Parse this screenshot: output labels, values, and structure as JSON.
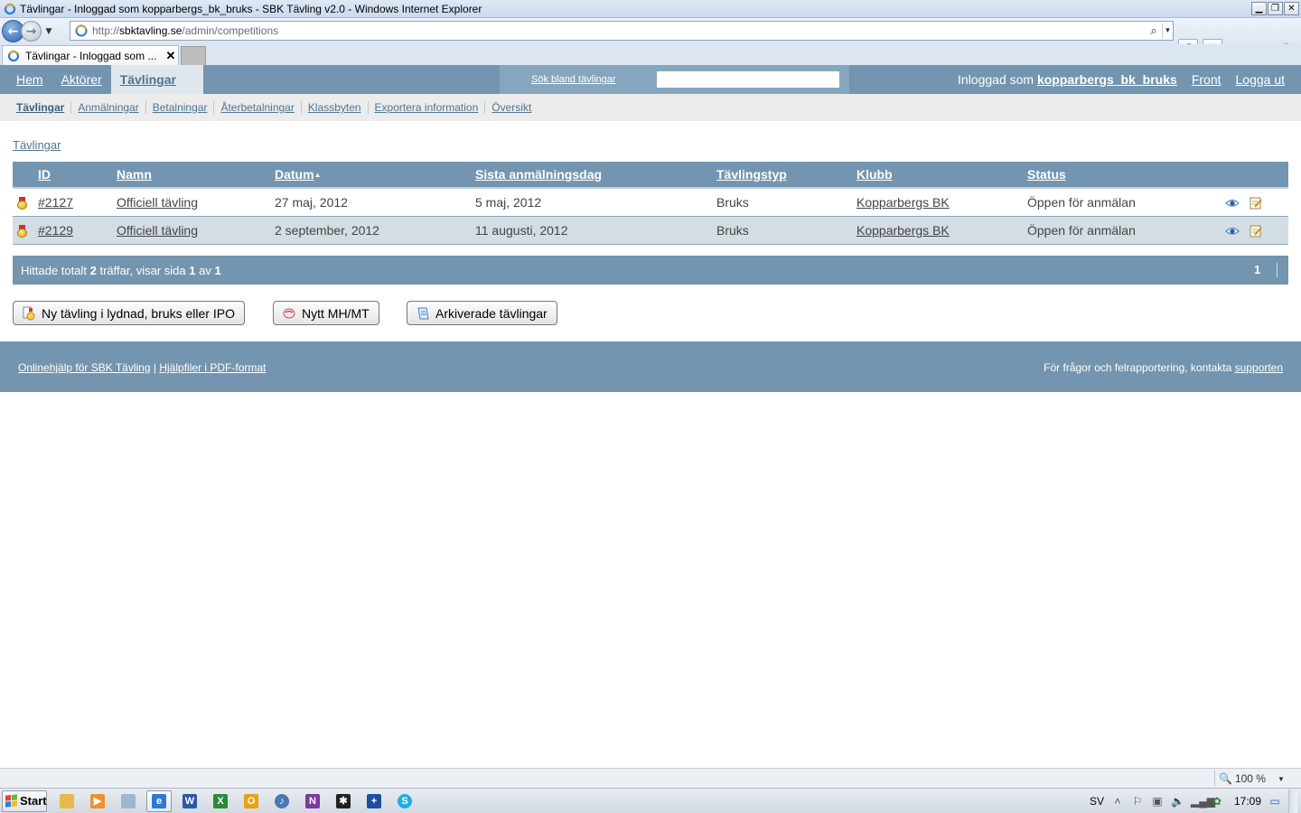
{
  "browser": {
    "window_title": "Tävlingar - Inloggad som kopparbergs_bk_bruks - SBK Tävling v2.0 - Windows Internet Explorer",
    "window_controls": [
      "minimize",
      "restore",
      "close"
    ],
    "address": {
      "scheme": "http://",
      "host": "sbktavling.se",
      "path": "/admin/competitions"
    },
    "tab_title": "Tävlingar - Inloggad som ...",
    "tab_close": "✕",
    "zoom": "100 %"
  },
  "header": {
    "main_nav": [
      "Hem",
      "Aktörer",
      "Tävlingar"
    ],
    "active_tab": "Tävlingar",
    "search_label": "Sök bland tävlingar",
    "search_value": "",
    "logged_in_prefix": "Inloggad som",
    "username": "kopparbergs_bk_bruks",
    "front_link": "Front",
    "logout_link": "Logga ut"
  },
  "subnav": [
    "Tävlingar",
    "Anmälningar",
    "Betalningar",
    "Återbetalningar",
    "Klassbyten",
    "Exportera information",
    "Översikt"
  ],
  "breadcrumb": "Tävlingar",
  "table": {
    "columns": [
      "ID",
      "Namn",
      "Datum",
      "Sista anmälningsdag",
      "Tävlingstyp",
      "Klubb",
      "Status"
    ],
    "sort_indicator": "▲",
    "rows": [
      {
        "id": "#2127",
        "name": "Officiell tävling",
        "date": "27 maj, 2012",
        "last_day": "5 maj, 2012",
        "type": "Bruks",
        "club": "Kopparbergs BK",
        "status": "Öppen för anmälan"
      },
      {
        "id": "#2129",
        "name": "Officiell tävling",
        "date": "2 september, 2012",
        "last_day": "11 augusti, 2012",
        "type": "Bruks",
        "club": "Kopparbergs BK",
        "status": "Öppen för anmälan"
      }
    ]
  },
  "pager": {
    "text_1": "Hittade totalt",
    "total": "2",
    "text_2": "träffar, visar sida",
    "page": "1",
    "text_3": "av",
    "pages": "1",
    "page_link": "1"
  },
  "actions": {
    "new_competition": "Ny tävling i lydnad, bruks eller IPO",
    "new_mhmt": "Nytt MH/MT",
    "archived": "Arkiverade tävlingar"
  },
  "footer": {
    "help_link": "Onlinehjälp för SBK Tävling",
    "separator": "|",
    "pdf_link": "Hjälpfiler i PDF-format",
    "contact_text": "För frågor och felrapportering, kontakta",
    "support_link": "supporten"
  },
  "taskbar": {
    "start": "Start",
    "language": "SV",
    "clock": "17:09",
    "apps": [
      "explorer-icon",
      "media-player-icon",
      "calculator-icon",
      "internet-explorer-icon",
      "word-icon",
      "excel-icon",
      "outlook-icon",
      "itunes-icon",
      "onenote-icon",
      "snipping-icon",
      "tabellen-icon",
      "skype-icon"
    ]
  },
  "colors": {
    "brand": "#7395af",
    "accent_text": "#4e7691",
    "alt_row": "#d3dde4"
  }
}
